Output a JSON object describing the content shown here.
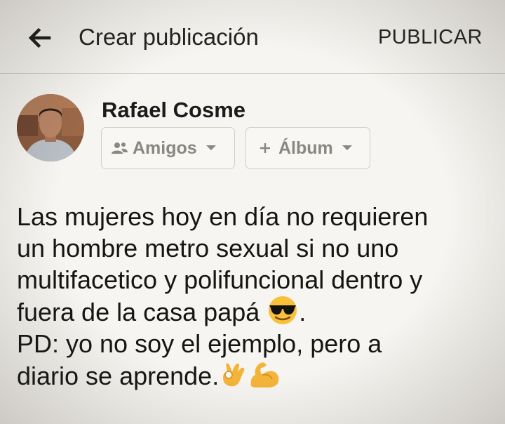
{
  "header": {
    "title": "Crear publicación",
    "publish_label": "PUBLICAR"
  },
  "user": {
    "name": "Rafael Cosme"
  },
  "chips": {
    "audience_label": "Amigos",
    "album_label": "Álbum"
  },
  "post": {
    "lines": [
      "Las mujeres hoy en día no requieren",
      "un hombre metro sexual si no uno",
      "multifacetico y polifuncional dentro y",
      "fuera de la casa papá",
      ".",
      "PD: yo no soy el ejemplo, pero a",
      "diario se aprende."
    ],
    "emojis": [
      "sunglasses-smiling-emoji",
      "ok-hand-emoji",
      "flexed-biceps-emoji"
    ]
  },
  "colors": {
    "background": "#f6f5f1",
    "text": "#1c1c1c",
    "chip_text": "#8a8782",
    "chip_border": "#d2cdc6",
    "divider": "#cfcac2"
  }
}
